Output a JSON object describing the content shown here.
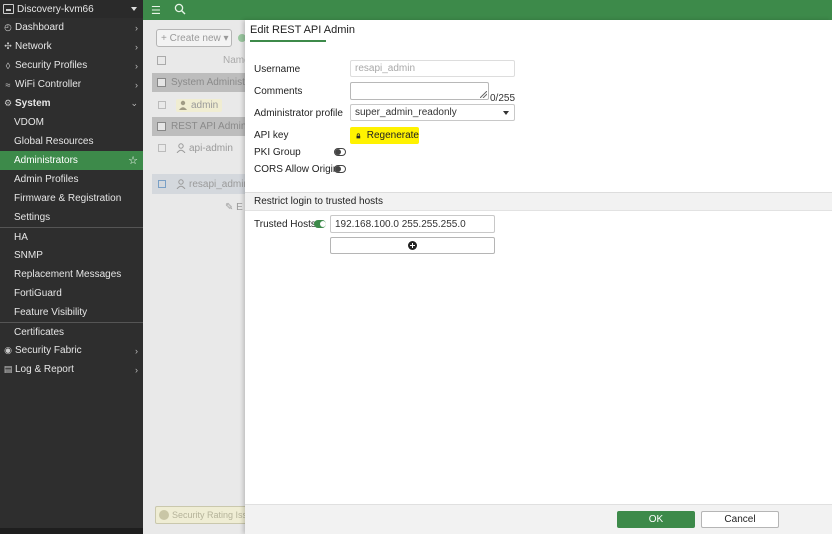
{
  "sidebar": {
    "device_name": "Discovery-kvm66",
    "items": [
      {
        "label": "Dashboard",
        "icon": "dashboard-icon"
      },
      {
        "label": "Network",
        "icon": "network-icon"
      },
      {
        "label": "Security Profiles",
        "icon": "shield-icon"
      },
      {
        "label": "WiFi Controller",
        "icon": "wifi-icon"
      },
      {
        "label": "System",
        "icon": "gear-icon"
      }
    ],
    "system_subitems": [
      "VDOM",
      "Global Resources",
      "Administrators",
      "Admin Profiles",
      "Firmware & Registration",
      "Settings",
      "HA",
      "SNMP",
      "Replacement Messages",
      "FortiGuard",
      "Feature Visibility",
      "Certificates"
    ],
    "bottom_items": [
      {
        "label": "Security Fabric",
        "icon": "fabric-icon"
      },
      {
        "label": "Log & Report",
        "icon": "log-icon"
      }
    ]
  },
  "background": {
    "create_new": "Create new",
    "name_header": "Name",
    "group_system": "System Administrator",
    "row_admin": "admin",
    "group_rest": "REST API Administrator",
    "row_api": "api-admin",
    "row_resapi": "resapi_admin",
    "edit_label": "E",
    "footer_badge": "Security Rating Issues"
  },
  "dialog": {
    "title": "Edit REST API Admin",
    "username_label": "Username",
    "username_value": "resapi_admin",
    "comments_label": "Comments",
    "comments_counter": "0/255",
    "profile_label": "Administrator profile",
    "profile_value": "super_admin_readonly",
    "api_key_label": "API key",
    "regenerate_label": "Regenerate",
    "pki_label": "PKI Group",
    "cors_label": "CORS Allow Origin",
    "section_label": "Restrict login to trusted hosts",
    "trusted_hosts_label": "Trusted Hosts",
    "trusted_host_value": "192.168.100.0 255.255.255.0",
    "ok_label": "OK",
    "cancel_label": "Cancel"
  },
  "colors": {
    "brand_green": "#3d8a4a",
    "highlight_yellow": "#fff200",
    "sidebar_bg": "#2e2e2e"
  }
}
